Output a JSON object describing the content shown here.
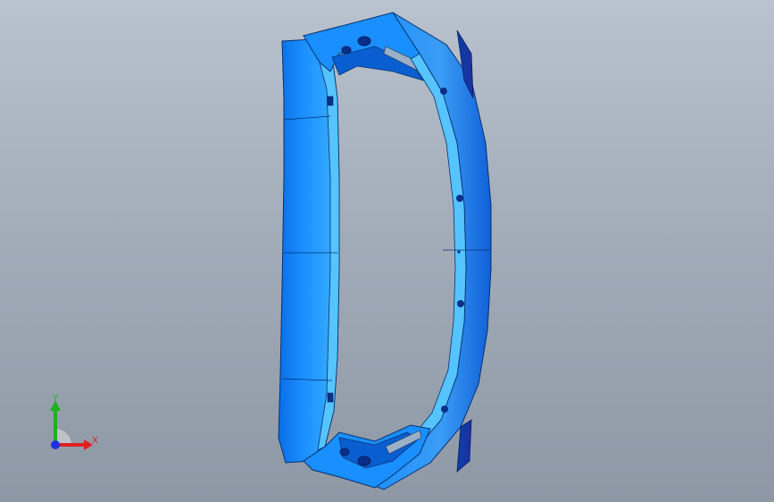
{
  "viewport": {
    "part_name": "front-bumper-frame",
    "colors": {
      "background_top": "#b9c3cf",
      "background_bottom": "#8e98a5",
      "part_main": "#1a8fff",
      "part_light": "#55c4ff",
      "part_dark": "#0a5fd0",
      "part_shadow": "#0a2f8a",
      "edge": "#083070"
    }
  },
  "triad": {
    "x_label": "X",
    "y_label": "Y",
    "x_color": "#e02020",
    "y_color": "#20b020",
    "z_color": "#2030e0"
  }
}
